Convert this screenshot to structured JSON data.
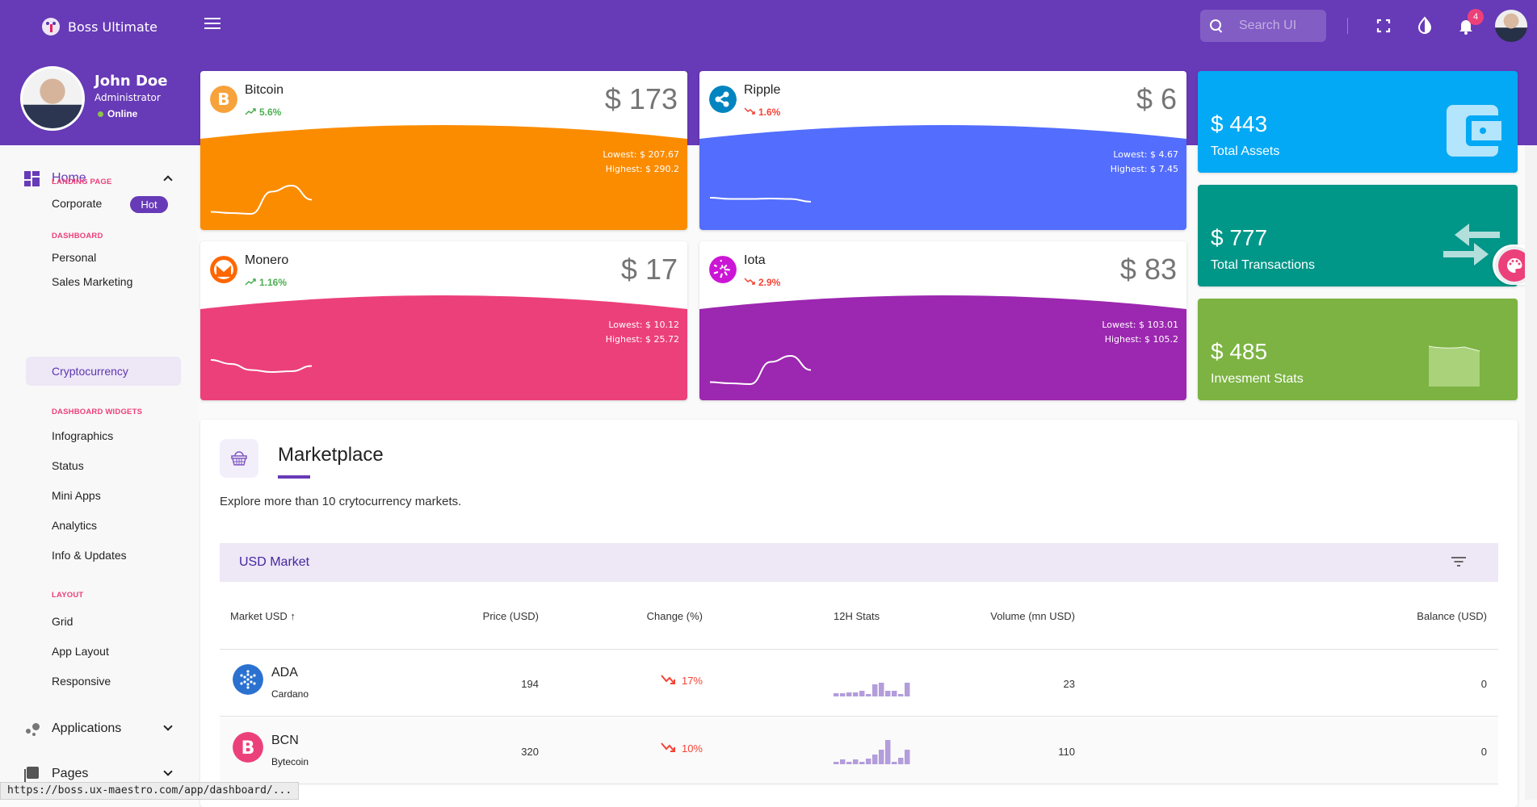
{
  "header": {
    "brand": "Boss Ultimate",
    "search_placeholder": "Search UI",
    "notification_count": "4",
    "icons": [
      "menu-icon",
      "search-icon",
      "fullscreen-icon",
      "contrast-icon",
      "bell-icon",
      "avatar"
    ]
  },
  "profile": {
    "name": "John Doe",
    "role": "Administrator",
    "status": "Online"
  },
  "sidebar": {
    "home": "Home",
    "sections": [
      {
        "label": "LANDING PAGE",
        "items": [
          {
            "label": "Corporate",
            "badge": "Hot"
          }
        ]
      },
      {
        "label": "DASHBOARD",
        "items": [
          {
            "label": "Personal"
          },
          {
            "label": "Sales Marketing"
          },
          {
            "label": "Cryptocurrency",
            "active": true
          }
        ]
      },
      {
        "label": "DASHBOARD WIDGETS",
        "items": [
          {
            "label": "Infographics"
          },
          {
            "label": "Status"
          },
          {
            "label": "Mini Apps"
          },
          {
            "label": "Analytics"
          },
          {
            "label": "Info & Updates"
          }
        ]
      },
      {
        "label": "LAYOUT",
        "items": [
          {
            "label": "Grid"
          },
          {
            "label": "App Layout"
          },
          {
            "label": "Responsive"
          }
        ]
      }
    ],
    "groups": [
      {
        "label": "Applications"
      },
      {
        "label": "Pages"
      }
    ]
  },
  "crypto_cards": [
    {
      "name": "Bitcoin",
      "change": "5.6%",
      "trend": "up",
      "price": "$ 173",
      "lowest": "Lowest: $ 207.67",
      "highest": "Highest: $ 290.2",
      "color": "#FB8C00",
      "icon_color": "#F7A23B",
      "spark": [
        0.25,
        0.22,
        0.2,
        0.75,
        0.9,
        0.55
      ]
    },
    {
      "name": "Ripple",
      "change": "1.6%",
      "trend": "down",
      "price": "$ 6",
      "lowest": "Lowest: $ 4.67",
      "highest": "Highest: $ 7.45",
      "color": "#536DFE",
      "icon_color": "#0085C0",
      "spark": [
        0.6,
        0.57,
        0.57,
        0.58,
        0.57,
        0.5
      ]
    },
    {
      "name": "Monero",
      "change": "1.16%",
      "trend": "up",
      "price": "$ 17",
      "lowest": "Lowest: $ 10.12",
      "highest": "Highest: $ 25.72",
      "color": "#EC407A",
      "icon_color": "#FF6600",
      "spark": [
        0.8,
        0.7,
        0.55,
        0.5,
        0.52,
        0.65
      ]
    },
    {
      "name": "Iota",
      "change": "2.9%",
      "trend": "down",
      "price": "$ 83",
      "lowest": "Lowest: $ 103.01",
      "highest": "Highest: $ 105.2",
      "color": "#9C27B0",
      "icon_color": "#CC16D6",
      "spark": [
        0.25,
        0.22,
        0.2,
        0.75,
        0.9,
        0.55
      ]
    }
  ],
  "stat_cards": [
    {
      "value": "$ 443",
      "label": "Total Assets",
      "color": "#03A9F4",
      "icon": "wallet-icon"
    },
    {
      "value": "$ 777",
      "label": "Total Transactions",
      "color": "#009688",
      "icon": "compare-arrows-icon"
    },
    {
      "value": "$ 485",
      "label": "Invesment Stats",
      "color": "#7CB342",
      "icon": "area-chart-icon"
    }
  ],
  "marketplace": {
    "title": "Marketplace",
    "description": "Explore more than 10 crytocurrency markets.",
    "market_title": "USD Market",
    "columns": [
      "Market USD",
      "Price (USD)",
      "Change (%)",
      "12H Stats",
      "Volume (mn USD)",
      "Balance (USD)"
    ],
    "rows": [
      {
        "symbol": "ADA",
        "name": "Cardano",
        "price": "194",
        "change": "17%",
        "trend": "down",
        "volume": "23",
        "balance": "0",
        "icon_color": "#2A71D0",
        "stats": [
          4,
          4,
          5,
          5,
          7,
          3,
          15,
          17,
          7,
          7,
          3,
          17
        ]
      },
      {
        "symbol": "BCN",
        "name": "Bytecoin",
        "price": "320",
        "change": "10%",
        "trend": "down",
        "volume": "110",
        "balance": "0",
        "icon_color": "#EC407A",
        "stats": [
          3,
          6,
          3,
          6,
          3,
          7,
          12,
          18,
          30,
          3,
          8,
          18
        ]
      }
    ]
  },
  "status_bar_url": "https://boss.ux-maestro.com/app/dashboard/..."
}
